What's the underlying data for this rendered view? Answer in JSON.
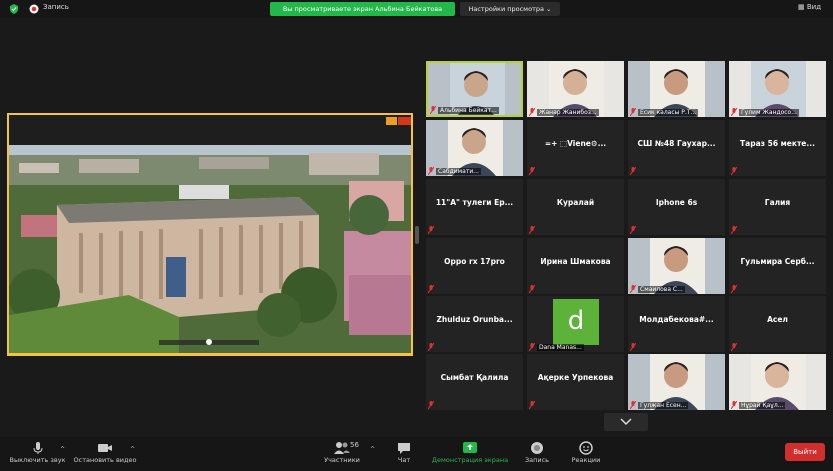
{
  "topbar": {
    "recording": "Запись",
    "banner": "Вы просматриваете экран Альбина Бейкатова",
    "view_options": "Настройки просмотра",
    "view": "Вид"
  },
  "gallery": [
    {
      "label": "Альбина Бейкат...",
      "photo": true
    },
    {
      "label": "Жанар Жанибоз...",
      "photo": true
    },
    {
      "label": "Есик каласы Р.Т...",
      "photo": true
    },
    {
      "label": "Гулим Жандосо...",
      "photo": true
    },
    {
      "label": "Сабдимати...",
      "photo": true
    },
    {
      "name": "=+ ⬚Viene⚙...",
      "label": ""
    },
    {
      "name": "СШ №48 Гаухар...",
      "label": ""
    },
    {
      "name": "Тараз 56 мекте...",
      "label": ""
    },
    {
      "name": "11\"А\" тулеги Ер...",
      "label": ""
    },
    {
      "name": "Куралай",
      "label": ""
    },
    {
      "name": "Iphone 6s",
      "label": ""
    },
    {
      "name": "Галия",
      "label": ""
    },
    {
      "name": "Oppo rx 17pro",
      "label": ""
    },
    {
      "name": "Ирина Шмакова",
      "label": ""
    },
    {
      "label": "Смаилова С...",
      "photo": true
    },
    {
      "name": "Гульмира Серб...",
      "label": ""
    },
    {
      "name": "Zhulduz Orunba...",
      "label": ""
    },
    {
      "label": "Dana Manas...",
      "avatar": "d"
    },
    {
      "name": "Молдабекова#...",
      "label": ""
    },
    {
      "name": "Асел",
      "label": ""
    },
    {
      "name": "Сымбат Қалила",
      "label": ""
    },
    {
      "name": "Ақерке Урпекова",
      "label": ""
    },
    {
      "label": "Гулжан Есен...",
      "photo": true
    },
    {
      "label": "Нұрай Қаұл...",
      "photo": true
    }
  ],
  "toolbar": {
    "mute": "Выключить звук",
    "video": "Остановить видео",
    "participants_label": "Участники",
    "participants_count": "56",
    "chat": "Чат",
    "share": "Демонстрация экрана",
    "record": "Запись",
    "reactions": "Реакции",
    "leave": "Выйти"
  },
  "colors": {
    "accent": "#23b84a",
    "leave": "#d12e2e",
    "active_border": "#b6d13b",
    "avatar": "#5db33a"
  }
}
